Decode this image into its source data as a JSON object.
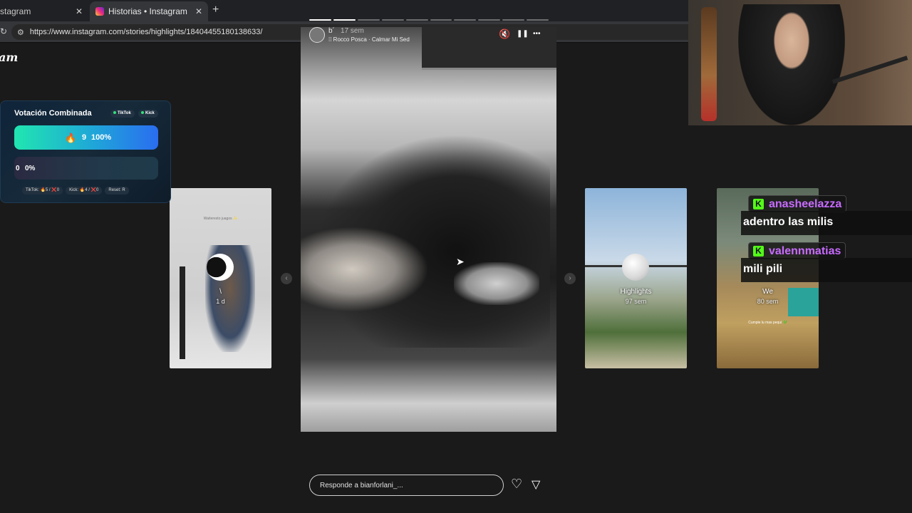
{
  "browser": {
    "tabs": [
      {
        "label": "stagram",
        "active": false
      },
      {
        "label": "Historias • Instagram",
        "active": true
      }
    ],
    "close_glyph": "✕",
    "new_tab_glyph": "+",
    "url": "https://www.instagram.com/stories/highlights/18404455180138633/"
  },
  "instagram": {
    "logo": "am",
    "story": {
      "user": "b´",
      "time": "17 sem",
      "music": "⁞⁞ Rocco Posca · Calmar Mi Sed",
      "progress_total": 10,
      "progress_done": 2,
      "reply_placeholder": "Responde a bianforlani_..."
    },
    "side_cards": [
      {
        "label": "\\",
        "sub": "1 d",
        "caption": "Waiteresto juagos ✨"
      },
      {
        "label": "Highlights",
        "sub": "97 sem"
      },
      {
        "label": "We",
        "sub": "80 sem",
        "caption": "Cumple lu mas pequi 💚"
      }
    ]
  },
  "vote_widget": {
    "title": "Votación Combinada",
    "pill_tiktok": "TikTok",
    "pill_kick": "Kick",
    "option_a": {
      "count": "9",
      "percent": "100%",
      "fill_fraction": 1.0
    },
    "option_b": {
      "count": "0",
      "percent": "0%",
      "fill_fraction": 0.0
    },
    "footer": [
      "TikTok: 🔥5 / ❌0",
      "Kick: 🔥4 / ❌0",
      "Reset: R"
    ]
  },
  "chat": [
    {
      "user": "anasheelazza",
      "message": "adentro las milis"
    },
    {
      "user": "valennmatias",
      "message": "mili pili"
    }
  ],
  "colors": {
    "chat_username": "#c86bff",
    "kick_green": "#53fc18",
    "vote_bar_start": "#20e6b0",
    "vote_bar_end": "#2a6df0"
  },
  "icons": {
    "mute": "🔇",
    "pause": "❚❚",
    "more": "•••",
    "heart": "♡",
    "share": "▽",
    "flame": "🔥",
    "prev": "‹",
    "next": "›",
    "kick": "K",
    "reload": "↻",
    "site_settings": "⚙"
  }
}
